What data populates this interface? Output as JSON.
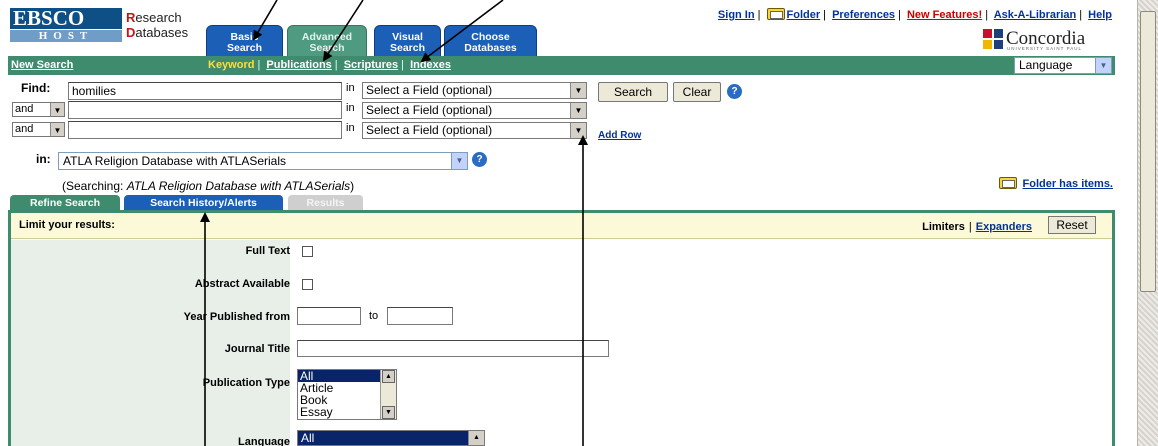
{
  "logo": {
    "line1": "EBSCO",
    "line2": "HOST"
  },
  "brand": {
    "line1": "Research",
    "line2": "Databases"
  },
  "tabs": [
    {
      "label1": "Basic",
      "label2": "Search"
    },
    {
      "label1": "Advanced",
      "label2": "Search"
    },
    {
      "label1": "Visual",
      "label2": "Search"
    },
    {
      "label1": "Choose",
      "label2": "Databases"
    }
  ],
  "top_links": {
    "sign_in": "Sign In",
    "folder": "Folder",
    "preferences": "Preferences",
    "new_features": "New Features!",
    "ask": "Ask-A-Librarian",
    "help": "Help"
  },
  "institution": {
    "name": "Concordia",
    "sub": "UNIVERSITY SAINT PAUL"
  },
  "nav": {
    "new_search": "New Search",
    "keyword": "Keyword",
    "publications": "Publications",
    "scriptures": "Scriptures",
    "indexes": "Indexes",
    "language": "Language"
  },
  "find": {
    "label": "Find:",
    "in_label": "in",
    "rows": [
      {
        "bool": "",
        "value": "homilies",
        "field": "Select a Field (optional)"
      },
      {
        "bool": "and",
        "value": "",
        "field": "Select a Field (optional)"
      },
      {
        "bool": "and",
        "value": "",
        "field": "Select a Field (optional)"
      }
    ],
    "search_button": "Search",
    "clear_button": "Clear",
    "add_row": "Add Row"
  },
  "database": {
    "in_label": "in:",
    "selected": "ATLA Religion Database with ATLASerials",
    "searching_prefix": "(Searching:",
    "searching_name": "ATLA Religion Database with ATLASerials",
    "searching_suffix": ")",
    "folder_has_items": "Folder has items."
  },
  "lower_tabs": [
    "Refine Search",
    "Search History/Alerts",
    "Results"
  ],
  "limits": {
    "title": "Limit your results:",
    "limiters": "Limiters",
    "expanders": "Expanders",
    "reset": "Reset",
    "full_text": "Full Text",
    "abstract": "Abstract Available",
    "year_from": "Year Published from",
    "to": "to",
    "journal_title": "Journal Title",
    "publication_type": "Publication Type",
    "pub_type_options": [
      "All",
      "Article",
      "Book",
      "Essay"
    ],
    "language": "Language",
    "language_selected": "All"
  }
}
